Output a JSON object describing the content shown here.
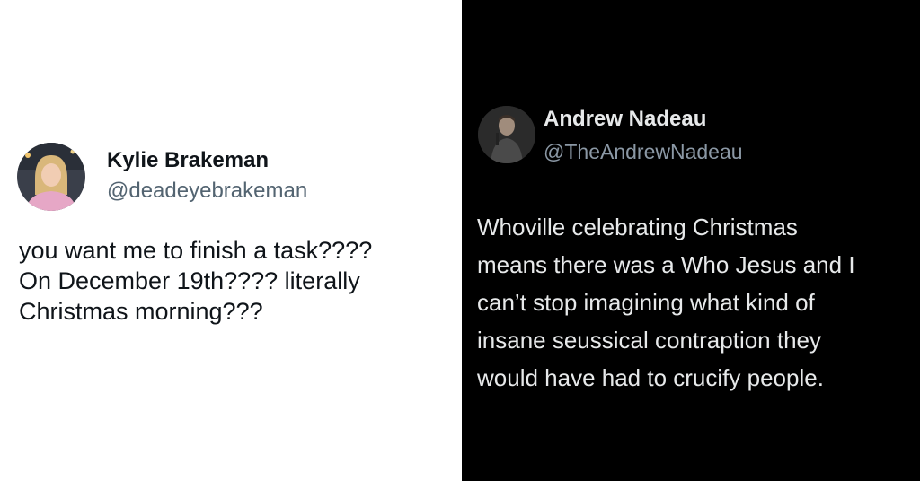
{
  "left_tweet": {
    "author_name": "Kylie Brakeman",
    "author_handle": "@deadeyebrakeman",
    "avatar_icon": "avatar-photo",
    "text_lines": [
      "you want me to finish a task????",
      "On December 19th???? literally",
      "Christmas morning???"
    ],
    "background": "#ffffff"
  },
  "right_tweet": {
    "author_name": "Andrew Nadeau",
    "author_handle": "@TheAndrewNadeau",
    "avatar_icon": "avatar-photo",
    "text_lines": [
      "Whoville celebrating Christmas",
      "means there was a Who Jesus and I",
      "can’t stop imagining what kind of",
      "insane seussical contraption they",
      "would have had to crucify people."
    ],
    "background": "#000000"
  }
}
